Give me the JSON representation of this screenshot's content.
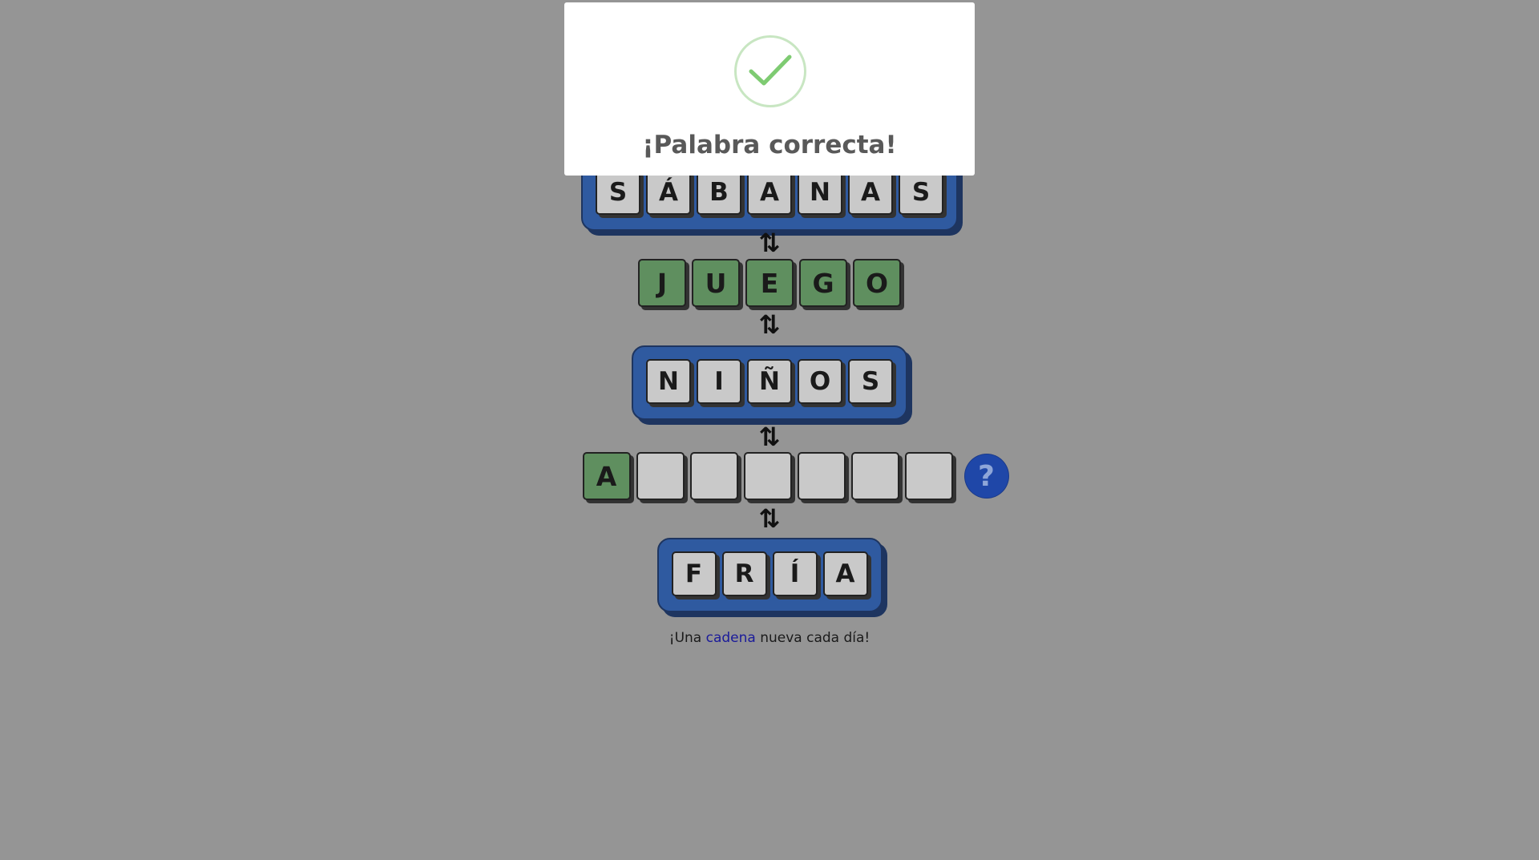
{
  "modal": {
    "title": "¡Palabra correcta!",
    "icon": "check-icon"
  },
  "words": [
    {
      "letters": [
        "S",
        "Á",
        "B",
        "A",
        "N",
        "A",
        "S"
      ],
      "state": "solved"
    },
    {
      "letters": [
        "J",
        "U",
        "E",
        "G",
        "O"
      ],
      "state": "given"
    },
    {
      "letters": [
        "N",
        "I",
        "Ñ",
        "O",
        "S"
      ],
      "state": "solved"
    },
    {
      "letters": [
        "A",
        "",
        "",
        "",
        "",
        "",
        ""
      ],
      "state": "active"
    },
    {
      "letters": [
        "F",
        "R",
        "Í",
        "A"
      ],
      "state": "solved"
    }
  ],
  "link_arrow": "⇅",
  "hint_button": "?",
  "tagline": {
    "before": "¡Una ",
    "link": "cadena",
    "after": " nueva cada día!"
  },
  "colors": {
    "background": "#959595",
    "frame": "#2f5aa0",
    "tile": "#c9c9c9",
    "tile_green": "#5f8f5f",
    "hint": "#1f47a8",
    "check": "#7ecb72"
  }
}
